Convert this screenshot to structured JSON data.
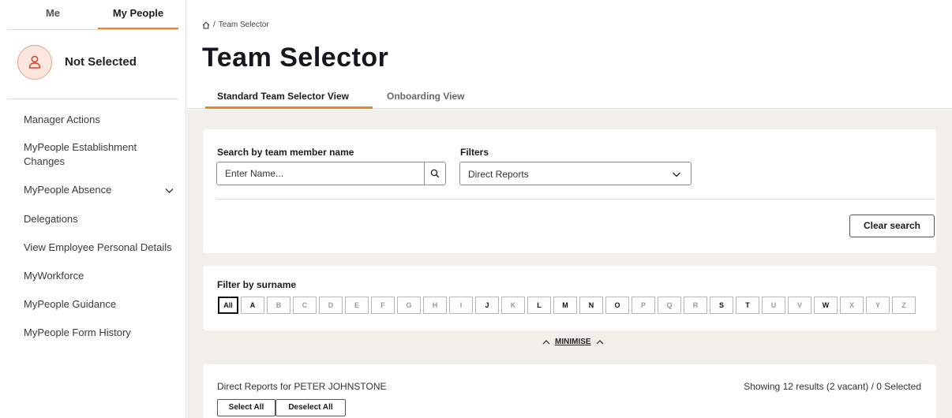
{
  "sidebar": {
    "tabs": [
      {
        "label": "Me"
      },
      {
        "label": "My People"
      }
    ],
    "profile": {
      "name": "Not Selected",
      "icon": "person-icon"
    },
    "items": [
      {
        "label": "Manager Actions"
      },
      {
        "label": "MyPeople Establishment Changes"
      },
      {
        "label": "MyPeople Absence",
        "expandable": true
      },
      {
        "label": "Delegations"
      },
      {
        "label": "View Employee Personal Details"
      },
      {
        "label": "MyWorkforce"
      },
      {
        "label": "MyPeople Guidance"
      },
      {
        "label": "MyPeople Form History"
      }
    ]
  },
  "header": {
    "breadcrumb": {
      "home_icon": "home-icon",
      "separator": "/",
      "current": "Team Selector"
    },
    "title": "Team Selector",
    "tabs": [
      {
        "label": "Standard Team Selector View",
        "active": true
      },
      {
        "label": "Onboarding View",
        "active": false
      }
    ]
  },
  "search": {
    "name_label": "Search by team member name",
    "name_placeholder": "Enter Name...",
    "filters_label": "Filters",
    "filter_value": "Direct Reports",
    "clear_label": "Clear search"
  },
  "surname_filter": {
    "label": "Filter by surname",
    "letters": [
      {
        "l": "All",
        "state": "selected"
      },
      {
        "l": "A",
        "state": "on"
      },
      {
        "l": "B",
        "state": "off"
      },
      {
        "l": "C",
        "state": "off"
      },
      {
        "l": "D",
        "state": "off"
      },
      {
        "l": "E",
        "state": "off"
      },
      {
        "l": "F",
        "state": "off"
      },
      {
        "l": "G",
        "state": "off"
      },
      {
        "l": "H",
        "state": "off"
      },
      {
        "l": "I",
        "state": "off"
      },
      {
        "l": "J",
        "state": "on"
      },
      {
        "l": "K",
        "state": "off"
      },
      {
        "l": "L",
        "state": "on"
      },
      {
        "l": "M",
        "state": "on"
      },
      {
        "l": "N",
        "state": "on"
      },
      {
        "l": "O",
        "state": "on"
      },
      {
        "l": "P",
        "state": "off"
      },
      {
        "l": "Q",
        "state": "off"
      },
      {
        "l": "R",
        "state": "off"
      },
      {
        "l": "S",
        "state": "on"
      },
      {
        "l": "T",
        "state": "on"
      },
      {
        "l": "U",
        "state": "off"
      },
      {
        "l": "V",
        "state": "off"
      },
      {
        "l": "W",
        "state": "on"
      },
      {
        "l": "X",
        "state": "off"
      },
      {
        "l": "Y",
        "state": "off"
      },
      {
        "l": "Z",
        "state": "off"
      }
    ],
    "minimise_label": "MINIMISE"
  },
  "results": {
    "title": "Direct Reports for PETER JOHNSTONE",
    "count": "Showing 12 results (2 vacant) / 0 Selected",
    "select_all": "Select All",
    "deselect_all": "Deselect All"
  },
  "colors": {
    "accent": "#f0821e",
    "background": "#f2efeb",
    "text": "#1b1b1b"
  }
}
